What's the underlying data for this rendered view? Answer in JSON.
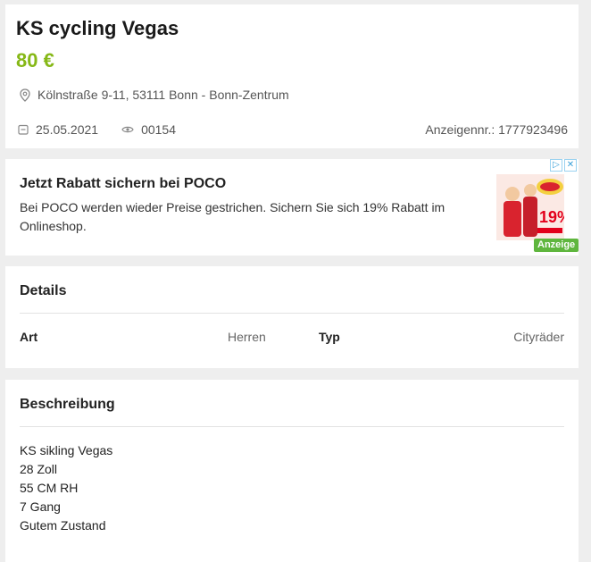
{
  "listing": {
    "title": "KS cycling Vegas",
    "price": "80 €",
    "location": "Kölnstraße 9-11, 53111 Bonn - Bonn-Zentrum",
    "date": "25.05.2021",
    "views": "00154",
    "ad_number": "Anzeigennr.: 1777923496"
  },
  "ad": {
    "title": "Jetzt Rabatt sichern bei POCO",
    "text": "Bei POCO werden wieder Preise gestrichen. Sichern Sie sich 19% Rabatt im Onlineshop.",
    "badge": "Anzeige",
    "image_text": "19%"
  },
  "details": {
    "heading": "Details",
    "rows": [
      {
        "label": "Art",
        "value": "Herren"
      },
      {
        "label": "Typ",
        "value": "Cityräder"
      }
    ]
  },
  "description": {
    "heading": "Beschreibung",
    "lines": [
      "KS sikling Vegas",
      "28 Zoll",
      "55 CM RH",
      "7 Gang",
      "Gutem Zustand"
    ]
  },
  "colors": {
    "price": "#86b817",
    "badge": "#5fb63e",
    "background": "#eeeeee"
  },
  "icons": {
    "location": "map-pin-icon",
    "date": "calendar-icon",
    "views": "eye-icon"
  }
}
